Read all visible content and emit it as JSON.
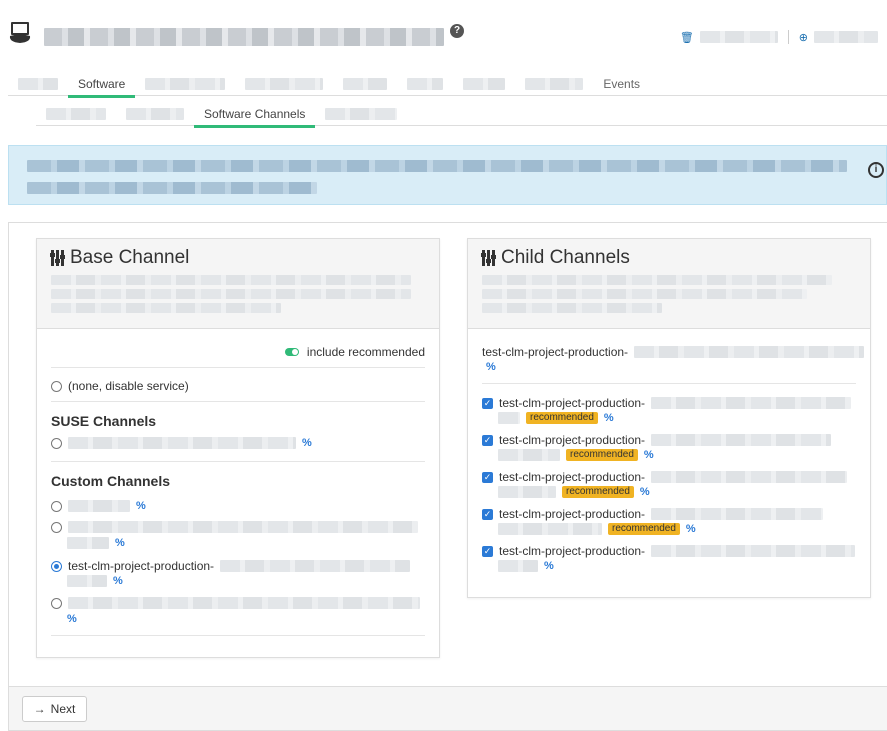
{
  "header": {
    "help_icon": "?",
    "delete_icon": "trash-icon",
    "add_icon": "plus-circle-icon"
  },
  "tabs": {
    "software": "Software",
    "events": "Events"
  },
  "subtabs": {
    "software_channels": "Software Channels"
  },
  "info_icon": "i",
  "base_channel": {
    "title": "Base Channel",
    "include_recommended": "include recommended",
    "none_option": "(none, disable service)",
    "suse_heading": "SUSE Channels",
    "custom_heading": "Custom Channels",
    "selected_prefix": "test-clm-project-production-"
  },
  "child_channels": {
    "title": "Child Channels",
    "parent_prefix": "test-clm-project-production-",
    "items": [
      {
        "prefix": "test-clm-project-production-",
        "badge": "recommended"
      },
      {
        "prefix": "test-clm-project-production-",
        "badge": "recommended"
      },
      {
        "prefix": "test-clm-project-production-",
        "badge": "recommended"
      },
      {
        "prefix": "test-clm-project-production-",
        "badge": "recommended"
      },
      {
        "prefix": "test-clm-project-production-",
        "badge": ""
      }
    ]
  },
  "footer": {
    "next_label": "Next",
    "next_icon": "→"
  },
  "colors": {
    "accent_green": "#30ba78",
    "link_blue": "#2b7ad6",
    "badge_yellow": "#f0b323",
    "info_bg": "#d9edf7"
  }
}
